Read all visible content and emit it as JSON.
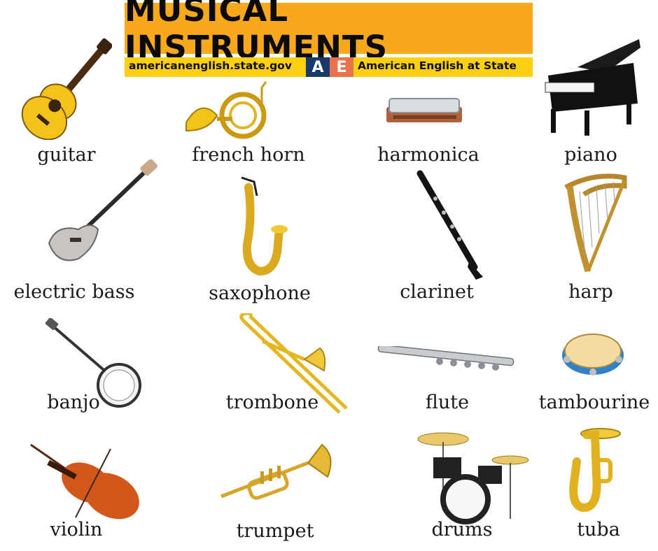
{
  "header": {
    "title": "MUSICAL INSTRUMENTS",
    "site": "americanenglish.state.gov",
    "badge_a": "A",
    "badge_e": "E",
    "org": "American English at State"
  },
  "colors": {
    "banner": "#f7a81b",
    "subbar": "#fccf10",
    "badge_a": "#183a6a",
    "badge_e": "#e8734a"
  },
  "instruments": [
    {
      "name": "guitar",
      "icon": "guitar-icon"
    },
    {
      "name": "french horn",
      "icon": "french-horn-icon"
    },
    {
      "name": "harmonica",
      "icon": "harmonica-icon"
    },
    {
      "name": "piano",
      "icon": "piano-icon"
    },
    {
      "name": "electric bass",
      "icon": "electric-bass-icon"
    },
    {
      "name": "saxophone",
      "icon": "saxophone-icon"
    },
    {
      "name": "clarinet",
      "icon": "clarinet-icon"
    },
    {
      "name": "harp",
      "icon": "harp-icon"
    },
    {
      "name": "banjo",
      "icon": "banjo-icon"
    },
    {
      "name": "trombone",
      "icon": "trombone-icon"
    },
    {
      "name": "flute",
      "icon": "flute-icon"
    },
    {
      "name": "tambourine",
      "icon": "tambourine-icon"
    },
    {
      "name": "violin",
      "icon": "violin-icon"
    },
    {
      "name": "trumpet",
      "icon": "trumpet-icon"
    },
    {
      "name": "drums",
      "icon": "drums-icon"
    },
    {
      "name": "tuba",
      "icon": "tuba-icon"
    }
  ]
}
